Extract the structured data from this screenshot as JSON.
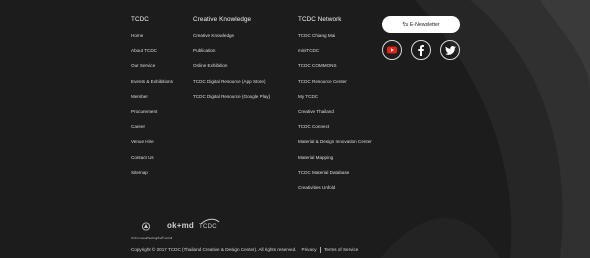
{
  "columns": [
    {
      "title": "TCDC",
      "items": [
        "Home",
        "About TCDC",
        "Our Service",
        "Events & Exhibitions",
        "Member",
        "Procurement",
        "Career",
        "Venue Hire",
        "Contact Us",
        "Sitemap"
      ]
    },
    {
      "title": "Creative Knowledge",
      "items": [
        "Creative Knowledge",
        "Publication",
        "Online Exhibition",
        "TCDC Digital Resource (App Store)",
        "TCDC Digital Resource (Google Play)"
      ]
    },
    {
      "title": "TCDC Network",
      "items": [
        "TCDC Chiang Mai",
        "miniTCDC",
        "TCDC COMMONS",
        "TCDC Resource Center",
        "My TCDC",
        "Creative Thailand",
        "TCDC Connect",
        "Material & Design Innovation Center",
        "Material Mapping",
        "TCDC Material Database",
        "Creativities Unfold"
      ]
    }
  ],
  "newsletter_label": "รับ E-Newsletter",
  "social": [
    "youtube-icon",
    "facebook-icon",
    "twitter-icon"
  ],
  "logos": {
    "cea_caption": "สำนักงานส่งเสริมเศรษฐกิจสร้างสรรค์",
    "middle_logo": "ok+md",
    "tcdc": "TCDC"
  },
  "footer": {
    "copyright": "Copyright © 2017 TCDC (Thailand Creative & Design Center). All rights reserved.",
    "privacy": "Privacy",
    "terms": "Terms of Service"
  },
  "colors": {
    "background": "#1c1c1c",
    "swoosh": "#2c2c2c",
    "youtube_red": "#e62117"
  }
}
